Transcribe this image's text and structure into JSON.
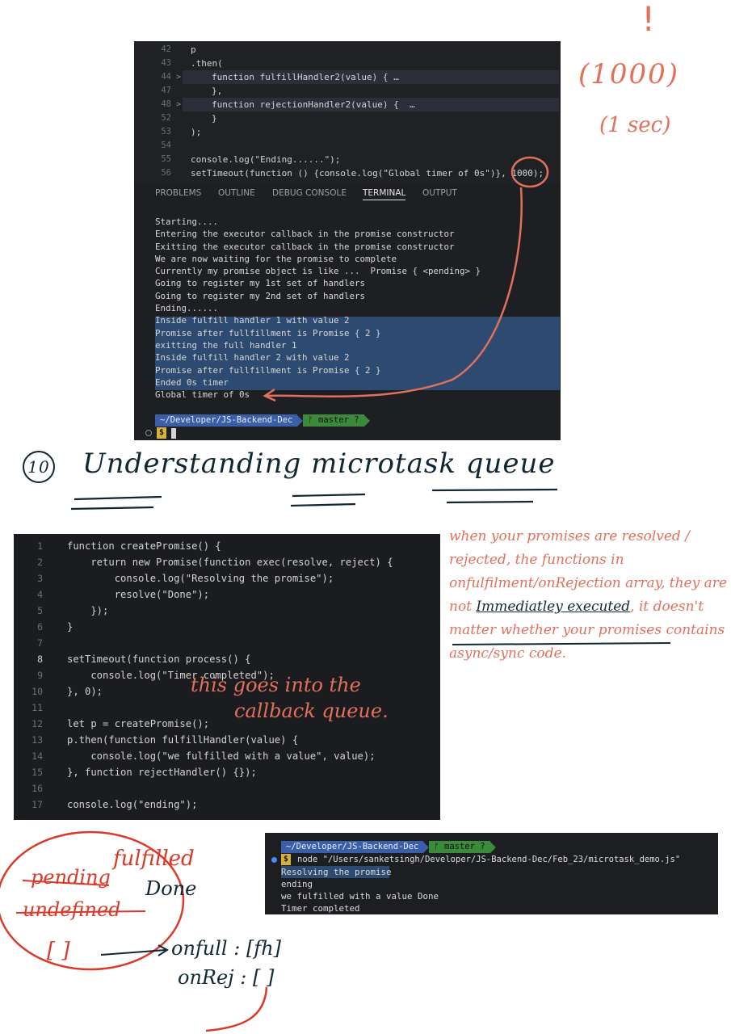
{
  "panel1": {
    "code_lines": [
      {
        "num": "42",
        "text": "p"
      },
      {
        "num": "43",
        "text": ".then("
      },
      {
        "num": "44",
        "fold": ">",
        "text": "function fulfillHandler2(value) { …"
      },
      {
        "num": "47",
        "text": "},"
      },
      {
        "num": "48",
        "fold": ">",
        "text": "function rejectionHandler2(value) {  …"
      },
      {
        "num": "52",
        "text": "}"
      },
      {
        "num": "53",
        "text": ");"
      },
      {
        "num": "54",
        "text": ""
      },
      {
        "num": "55",
        "text": "console.log(\"Ending......\");"
      },
      {
        "num": "56",
        "text": "setTimeout(function () {console.log(\"Global timer of 0s\")}, 1000);"
      }
    ],
    "tabs": [
      "PROBLEMS",
      "OUTLINE",
      "DEBUG CONSOLE",
      "TERMINAL",
      "OUTPUT"
    ],
    "active_tab": "TERMINAL",
    "terminal_lines": [
      "Starting....",
      "Entering the executor callback in the promise constructor",
      "Exitting the executor callback in the promise constructor",
      "We are now waiting for the promise to complete",
      "Currently my promise object is like ...  Promise { <pending> }",
      "Going to register my 1st set of handlers",
      "Going to register my 2nd set of handlers",
      "Ending......",
      "Inside fulfill handler 1 with value 2",
      "Promise after fullfillment is Promise { 2 }",
      "exitting the full handler 1",
      "Inside fulfill handler 2 with value 2",
      "Promise after fullfillment is Promise { 2 }",
      "Ended 0s timer",
      "Global timer of 0s"
    ],
    "prompt_path": "~/Developer/JS-Backend-Dec",
    "prompt_branch": "ᚠ master ?",
    "prompt_symbol": "$"
  },
  "annotations": {
    "exclaim": "!",
    "ms_value": "(1000)",
    "sec_value": "(1 sec)",
    "section_number": "10",
    "section_title": "Understanding microtask queue",
    "callback_note_1": "this goes into the",
    "callback_note_2": "callback queue.",
    "side_note_part1": "when your promises are resolved / rejected, the functions in onfulfilment/onRejection array, they are not",
    "side_note_underlined": "Immediatley executed",
    "side_note_part2": ", it doesn't matter whether your promises contains async/sync code.",
    "state_fulfilled": "fulfilled",
    "state_pending": "pending",
    "state_done": "Done",
    "state_undefined": "undefined",
    "state_array": "[ ]",
    "onfull_label": "onfull : [fh]",
    "onrej_label": "onRej : [ ]"
  },
  "panel2": {
    "code_lines": [
      {
        "num": "1",
        "text": "function createPromise() {"
      },
      {
        "num": "2",
        "text": "    return new Promise(function exec(resolve, reject) {"
      },
      {
        "num": "3",
        "text": "        console.log(\"Resolving the promise\");"
      },
      {
        "num": "4",
        "text": "        resolve(\"Done\");"
      },
      {
        "num": "5",
        "text": "    });"
      },
      {
        "num": "6",
        "text": "}"
      },
      {
        "num": "7",
        "text": ""
      },
      {
        "num": "8",
        "text": "setTimeout(function process() {"
      },
      {
        "num": "9",
        "text": "    console.log(\"Timer completed\");"
      },
      {
        "num": "10",
        "text": "}, 0);"
      },
      {
        "num": "11",
        "text": ""
      },
      {
        "num": "12",
        "text": "let p = createPromise();"
      },
      {
        "num": "13",
        "text": "p.then(function fulfillHandler(value) {"
      },
      {
        "num": "14",
        "text": "    console.log(\"we fulfilled with a value\", value);"
      },
      {
        "num": "15",
        "text": "}, function rejectHandler() {});"
      },
      {
        "num": "16",
        "text": ""
      },
      {
        "num": "17",
        "text": "console.log(\"ending\");"
      }
    ]
  },
  "panel3": {
    "prompt_path": "~/Developer/JS-Backend-Dec",
    "prompt_branch": "ᚠ master ?",
    "prompt_symbol": "$",
    "command": "node \"/Users/sanketsingh/Developer/JS-Backend-Dec/Feb_23/microtask_demo.js\"",
    "output": [
      "Resolving the promise",
      "ending",
      "we fulfilled with a value Done",
      "Timer completed"
    ]
  },
  "colors": {
    "annotation_orange": "#e2705a",
    "annotation_dark": "#0f2733",
    "terminal_selection": "#2d4a70",
    "prompt_blue": "#3a5fa8",
    "prompt_green": "#3c8b3c"
  }
}
